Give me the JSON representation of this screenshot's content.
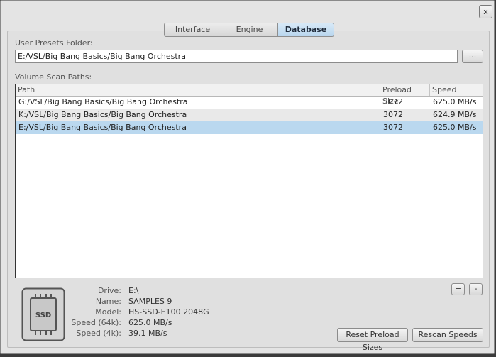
{
  "window": {
    "close_label": "x"
  },
  "tabs": [
    {
      "label": "Interface",
      "active": false
    },
    {
      "label": "Engine",
      "active": false
    },
    {
      "label": "Database",
      "active": true
    }
  ],
  "presets": {
    "label": "User Presets Folder:",
    "value": "E:/VSL/Big Bang Basics/Big Bang Orchestra",
    "browse_label": "..."
  },
  "scan": {
    "label": "Volume Scan Paths:",
    "columns": [
      "Path",
      "Preload Size",
      "Speed"
    ],
    "rows": [
      {
        "path": "G:/VSL/Big Bang Basics/Big Bang Orchestra",
        "preload": "3072",
        "speed": "625.0 MB/s"
      },
      {
        "path": "K:/VSL/Big Bang Basics/Big Bang Orchestra",
        "preload": "3072",
        "speed": "624.9 MB/s"
      },
      {
        "path": "E:/VSL/Big Bang Basics/Big Bang Orchestra",
        "preload": "3072",
        "speed": "625.0 MB/s"
      }
    ],
    "selected_row": 2
  },
  "drive": {
    "icon": "ssd-icon",
    "icon_text": "SSD",
    "fields": [
      {
        "key": "Drive:",
        "value": "E:\\"
      },
      {
        "key": "Name:",
        "value": "SAMPLES 9"
      },
      {
        "key": "Model:",
        "value": "HS-SSD-E100 2048G"
      },
      {
        "key": "Speed (64k):",
        "value": "625.0 MB/s"
      },
      {
        "key": "Speed (4k):",
        "value": "39.1 MB/s"
      }
    ]
  },
  "actions": {
    "add_label": "+",
    "remove_label": "-",
    "reset_label": "Reset Preload Sizes",
    "rescan_label": "Rescan Speeds"
  },
  "colors": {
    "accent": "#bad8ef",
    "tab_active": "#c9e0f3"
  }
}
